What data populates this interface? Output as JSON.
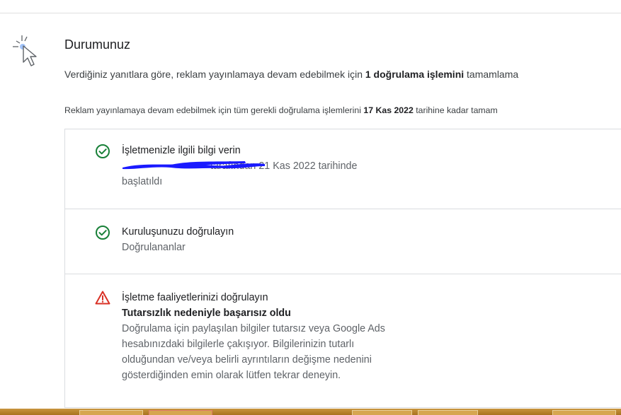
{
  "status": {
    "title": "Durumunuz",
    "intro_prefix": "Verdiğiniz yanıtlara göre, reklam yayınlamaya devam edebilmek için ",
    "intro_bold": "1 doğrulama işlemini",
    "intro_suffix": " tamamlama",
    "deadline_prefix": "Reklam yayınlamaya devam edebilmek için tüm gerekli doğrulama işlemlerini ",
    "deadline_bold": "17 Kas 2022",
    "deadline_suffix": " tarihine kadar tamam"
  },
  "items": [
    {
      "title": "İşletmenizle ilgili bilgi verin",
      "detail": "tarafından 21 Kas 2022 tarihinde",
      "detail2": "başlatıldı",
      "icon": "check-circle-icon",
      "color": "#188038"
    },
    {
      "title": "Kuruluşunuzu doğrulayın",
      "detail": "Doğrulananlar",
      "icon": "check-circle-icon",
      "color": "#188038"
    },
    {
      "title": "İşletme faaliyetlerinizi doğrulayın",
      "fail": "Tutarsızlık nedeniyle başarısız oldu",
      "desc": [
        "Doğrulama için paylaşılan bilgiler tutarsız veya Google Ads",
        "hesabınızdaki bilgilerle çakışıyor. Bilgilerinizin tutarlı",
        "olduğundan ve/veya belirli ayrıntıların değişme nedenini",
        "gösterdiğinden emin olarak lütfen tekrar deneyin."
      ],
      "icon": "warning-triangle-icon",
      "color": "#d93025"
    }
  ],
  "colors": {
    "success": "#188038",
    "error": "#d93025",
    "redaction": "#1a1aff"
  }
}
